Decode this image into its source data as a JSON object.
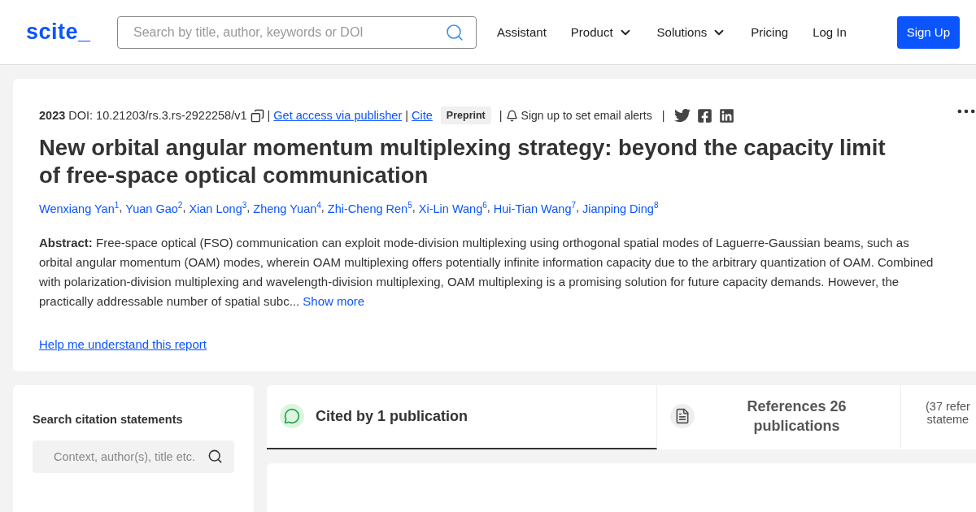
{
  "header": {
    "logo": "scite_",
    "search": {
      "placeholder": "Search by title, author, keywords or DOI"
    },
    "nav": [
      {
        "label": "Assistant",
        "dropdown": false
      },
      {
        "label": "Product",
        "dropdown": true
      },
      {
        "label": "Solutions",
        "dropdown": true
      },
      {
        "label": "Pricing",
        "dropdown": false
      },
      {
        "label": "Log In",
        "dropdown": false
      }
    ],
    "signup": "Sign Up"
  },
  "paper": {
    "separator": "|",
    "author_separator": ",",
    "year": "2023",
    "doi": "DOI: 10.21203/rs.3.rs-2922258/v1",
    "access": "Get access via publisher",
    "cite": "Cite",
    "badge": "Preprint",
    "alerts": "Sign up to set email alerts",
    "title": "New orbital angular momentum multiplexing strategy: beyond the capacity limit of free-space optical communication",
    "authors": [
      "Wenxiang Yan$^{1}$",
      "Yuan Gao$^{2}$",
      "Xian Long$^{3}$",
      "Zheng Yuan$^{4}$",
      "Zhi-Cheng Ren$^{5}$",
      "Xi-Lin Wang$^{6}$",
      "Hui-Tian Wang$^{7}$",
      "Jianping Ding$^{8}$"
    ],
    "abstract_label": "Abstract:",
    "abstract": "Free-space optical (FSO) communication can exploit mode-division multiplexing using orthogonal spatial modes of Laguerre-Gaussian beams, such as orbital angular momentum (OAM) modes, wherein OAM multiplexing offers potentially infinite information capacity due to the arbitrary quantization of OAM. Combined with polarization-division multiplexing and wavelength-division multiplexing, OAM multiplexing is a promising solution for future capacity demands. However, the practically addressable number of spatial subc...",
    "show_more": "Show more",
    "help": "Help me understand this report"
  },
  "citation_search": {
    "title": "Search citation statements",
    "placeholder": "Context, author(s), title etc."
  },
  "tabs": [
    {
      "label": "Cited by 1 publication",
      "selected": true
    },
    {
      "label": "References 26 publications",
      "selected": false
    }
  ],
  "tab_note": [
    "(37 refer",
    "stateme"
  ]
}
